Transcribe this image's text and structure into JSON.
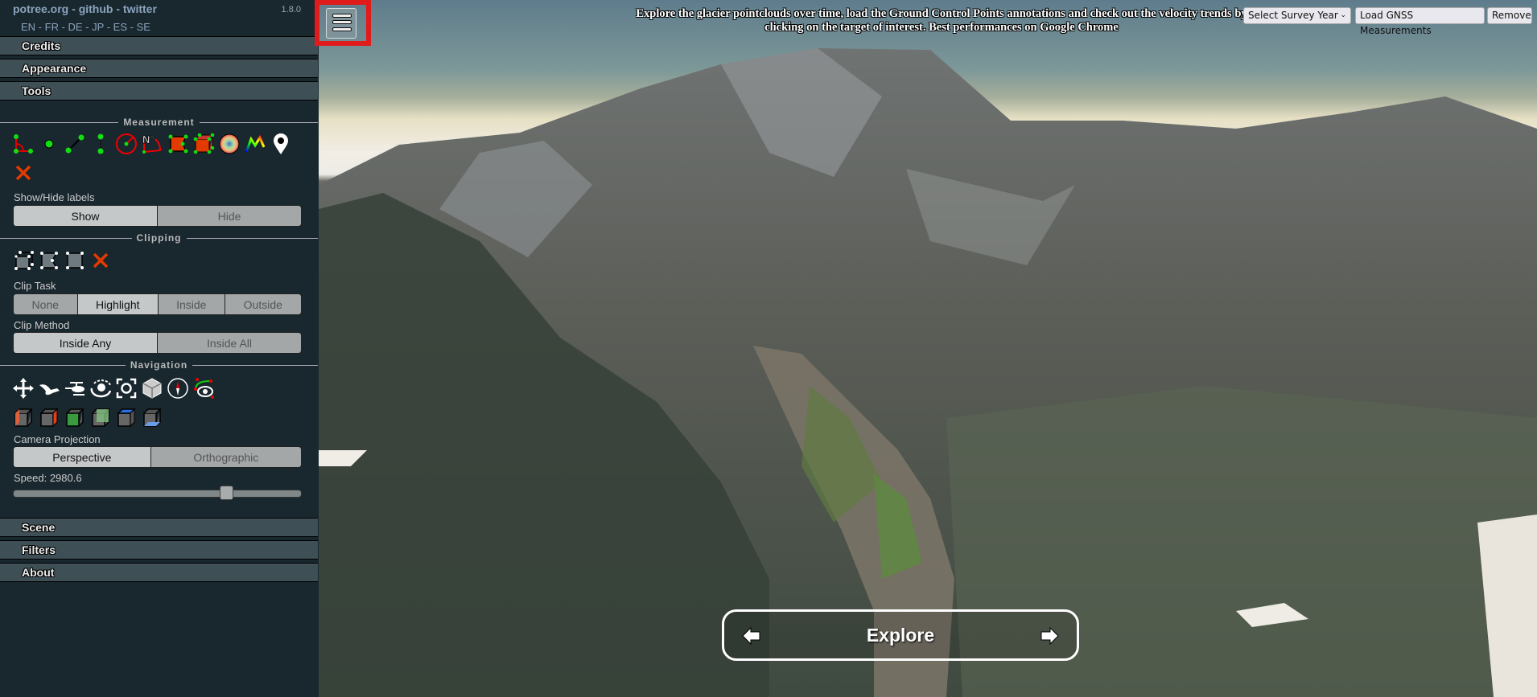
{
  "sidebar": {
    "brand": {
      "links": [
        "potree.org",
        "github",
        "twitter"
      ],
      "separator": " - "
    },
    "version": "1.8.0",
    "languages": [
      "EN",
      "FR",
      "DE",
      "JP",
      "ES",
      "SE"
    ],
    "sections_top": [
      "Credits",
      "Appearance",
      "Tools"
    ],
    "measurement": {
      "title": "Measurement",
      "tools": [
        "angle-tool",
        "point-tool",
        "distance-tool",
        "height-tool",
        "circle-tool",
        "azimuth-tool",
        "area-tool",
        "volume-tool",
        "sphere-volume-tool",
        "height-profile-tool",
        "annotation-tool",
        "remove-all-measurements"
      ],
      "labels_label": "Show/Hide labels",
      "labels_options": [
        "Show",
        "Hide"
      ],
      "labels_selected": "Show"
    },
    "clipping": {
      "title": "Clipping",
      "tools": [
        "clip-volume",
        "clip-polygon",
        "clip-screen-box",
        "remove-all-clipping"
      ],
      "task_label": "Clip Task",
      "task_options": [
        "None",
        "Highlight",
        "Inside",
        "Outside"
      ],
      "task_selected": "Highlight",
      "method_label": "Clip Method",
      "method_options": [
        "Inside Any",
        "Inside All"
      ],
      "method_selected": "Inside Any"
    },
    "navigation": {
      "title": "Navigation",
      "controls": [
        "earth-control",
        "fly-control",
        "helicopter-control",
        "orbit-control",
        "full-extent",
        "navigation-cube",
        "compass",
        "camera-animation"
      ],
      "views": [
        "left-view",
        "right-view",
        "front-view",
        "back-view",
        "top-view",
        "bottom-view"
      ],
      "projection_label": "Camera Projection",
      "projection_options": [
        "Perspective",
        "Orthographic"
      ],
      "projection_selected": "Perspective",
      "speed_label": "Speed: 2980.6",
      "speed_fraction": 0.74
    },
    "sections_bottom": [
      "Scene",
      "Filters",
      "About"
    ]
  },
  "headline": "Explore the glacier pointclouds over time, load the Ground Control Points annotations and check out the velocity trends by clicking on the target of interest. Best performances on Google Chrome",
  "toolbar": {
    "survey_select": "Select Survey Year",
    "load_button": "Load GNSS Measurements",
    "remove_button": "Remove"
  },
  "explore": {
    "title": "Explore"
  },
  "colors": {
    "menu_highlight": "#e01b1b",
    "sidebar_bg": "#19272e",
    "section_header": "#3e4f56"
  }
}
